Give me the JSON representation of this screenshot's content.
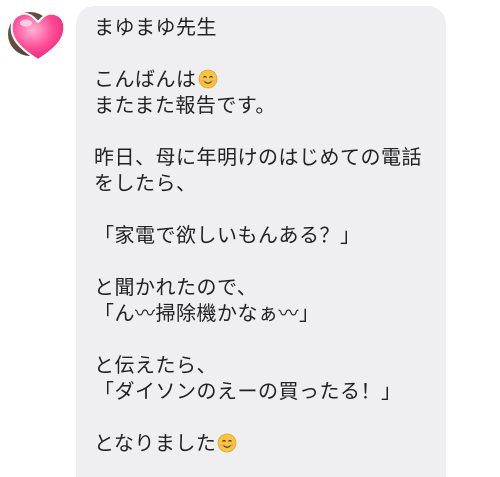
{
  "conversation": {
    "avatar": {
      "icon": "heart-icon",
      "color": "#ff3f8e"
    },
    "bubble_color": "#efeff2",
    "text_color": "#222222",
    "message_lines": [
      "まゆまゆ先生",
      "",
      "こんばんは",
      "またまた報告です。",
      "",
      "昨日、母に年明けのはじめての電話",
      "をしたら、",
      "",
      "「家電で欲しいもんある？」",
      "",
      "と聞かれたので、",
      "「ん〰掃除機かなぁ〰」",
      "",
      "と伝えたら、",
      "「ダイソンのえーの買ったる！」",
      "",
      "となりました"
    ],
    "emoji_lines": [
      2,
      16
    ],
    "emoji": {
      "icon": "smiling-face-emoji-icon",
      "color": "#f5c542"
    }
  }
}
